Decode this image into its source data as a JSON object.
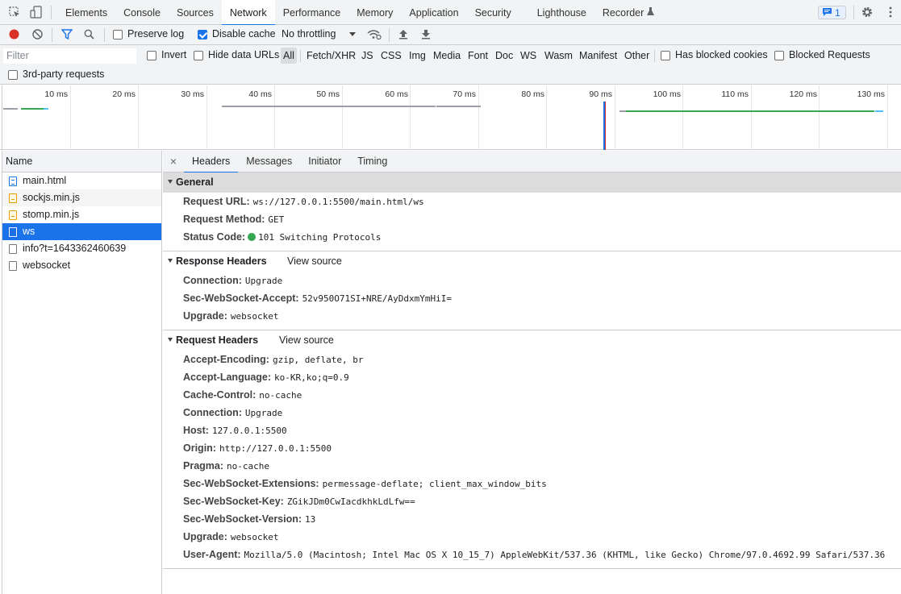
{
  "tabs": [
    "Elements",
    "Console",
    "Sources",
    "Network",
    "Performance",
    "Memory",
    "Application",
    "Security",
    "Lighthouse",
    "Recorder"
  ],
  "active_tab": "Network",
  "issues_count": "1",
  "toolbar": {
    "preserve_log": "Preserve log",
    "disable_cache": "Disable cache",
    "throttling": "No throttling"
  },
  "filter": {
    "placeholder": "Filter",
    "invert": "Invert",
    "hide_data_urls": "Hide data URLs",
    "types": [
      "All",
      "Fetch/XHR",
      "JS",
      "CSS",
      "Img",
      "Media",
      "Font",
      "Doc",
      "WS",
      "Wasm",
      "Manifest",
      "Other"
    ],
    "has_blocked_cookies": "Has blocked cookies",
    "blocked_requests": "Blocked Requests",
    "third_party": "3rd-party requests"
  },
  "timeline_ticks": [
    "10 ms",
    "20 ms",
    "30 ms",
    "40 ms",
    "50 ms",
    "60 ms",
    "70 ms",
    "80 ms",
    "90 ms",
    "100 ms",
    "110 ms",
    "120 ms",
    "130 ms"
  ],
  "name_header": "Name",
  "requests": [
    "main.html",
    "sockjs.min.js",
    "stomp.min.js",
    "ws",
    "info?t=1643362460639",
    "websocket"
  ],
  "detail_tabs": [
    "Headers",
    "Messages",
    "Initiator",
    "Timing"
  ],
  "general": {
    "title": "General",
    "rows": [
      {
        "name": "Request URL:",
        "value": "ws://127.0.0.1:5500/main.html/ws"
      },
      {
        "name": "Request Method:",
        "value": "GET"
      },
      {
        "name": "Status Code:",
        "value": "101 Switching Protocols"
      }
    ]
  },
  "response_headers": {
    "title": "Response Headers",
    "view_source": "View source",
    "rows": [
      {
        "name": "Connection:",
        "value": "Upgrade"
      },
      {
        "name": "Sec-WebSocket-Accept:",
        "value": "52v950O71SI+NRE/AyDdxmYmHiI="
      },
      {
        "name": "Upgrade:",
        "value": "websocket"
      }
    ]
  },
  "request_headers": {
    "title": "Request Headers",
    "view_source": "View source",
    "rows": [
      {
        "name": "Accept-Encoding:",
        "value": "gzip, deflate, br"
      },
      {
        "name": "Accept-Language:",
        "value": "ko-KR,ko;q=0.9"
      },
      {
        "name": "Cache-Control:",
        "value": "no-cache"
      },
      {
        "name": "Connection:",
        "value": "Upgrade"
      },
      {
        "name": "Host:",
        "value": "127.0.0.1:5500"
      },
      {
        "name": "Origin:",
        "value": "http://127.0.0.1:5500"
      },
      {
        "name": "Pragma:",
        "value": "no-cache"
      },
      {
        "name": "Sec-WebSocket-Extensions:",
        "value": "permessage-deflate; client_max_window_bits"
      },
      {
        "name": "Sec-WebSocket-Key:",
        "value": "ZGikJDm0CwIacdkhkLdLfw=="
      },
      {
        "name": "Sec-WebSocket-Version:",
        "value": "13"
      },
      {
        "name": "Upgrade:",
        "value": "websocket"
      },
      {
        "name": "User-Agent:",
        "value": "Mozilla/5.0 (Macintosh; Intel Mac OS X 10_15_7) AppleWebKit/537.36 (KHTML, like Gecko) Chrome/97.0.4692.99 Safari/537.36"
      }
    ]
  },
  "colors": {
    "accent": "#1a73e8",
    "record": "#d93025",
    "status_ok": "#34a853",
    "timeline_green": "#34a853",
    "timeline_gray": "#9aa0a6",
    "timeline_blue": "#4fc3f7"
  }
}
